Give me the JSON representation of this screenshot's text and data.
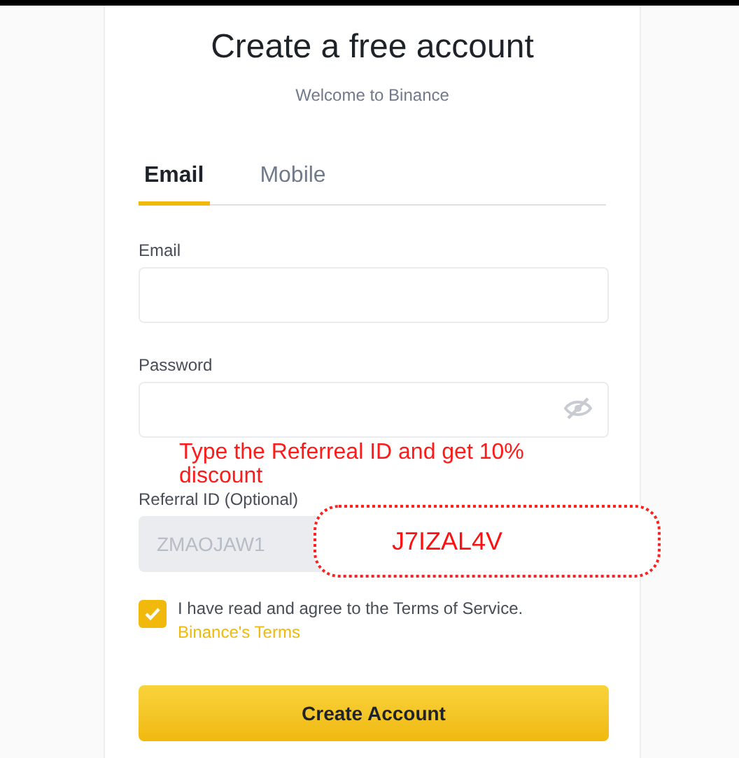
{
  "title": "Create a free account",
  "subtitle": "Welcome to Binance",
  "tabs": [
    {
      "label": "Email",
      "selected": true
    },
    {
      "label": "Mobile",
      "selected": false
    }
  ],
  "fields": [
    {
      "kind": "text",
      "label": "Email"
    },
    {
      "kind": "password",
      "label": "Password"
    },
    {
      "kind": "text",
      "label": "Referral ID (Optional)",
      "value": "ZMAOJAW1",
      "disabled": true
    }
  ],
  "agreement": {
    "checked": true,
    "text": "I have read and agree to the Terms of Service.",
    "link": "Binance's Terms"
  },
  "submit": "Create Account",
  "annotation": {
    "note": "Type the Referreal ID and get 10% discount",
    "code": "J7IZAL4V"
  }
}
